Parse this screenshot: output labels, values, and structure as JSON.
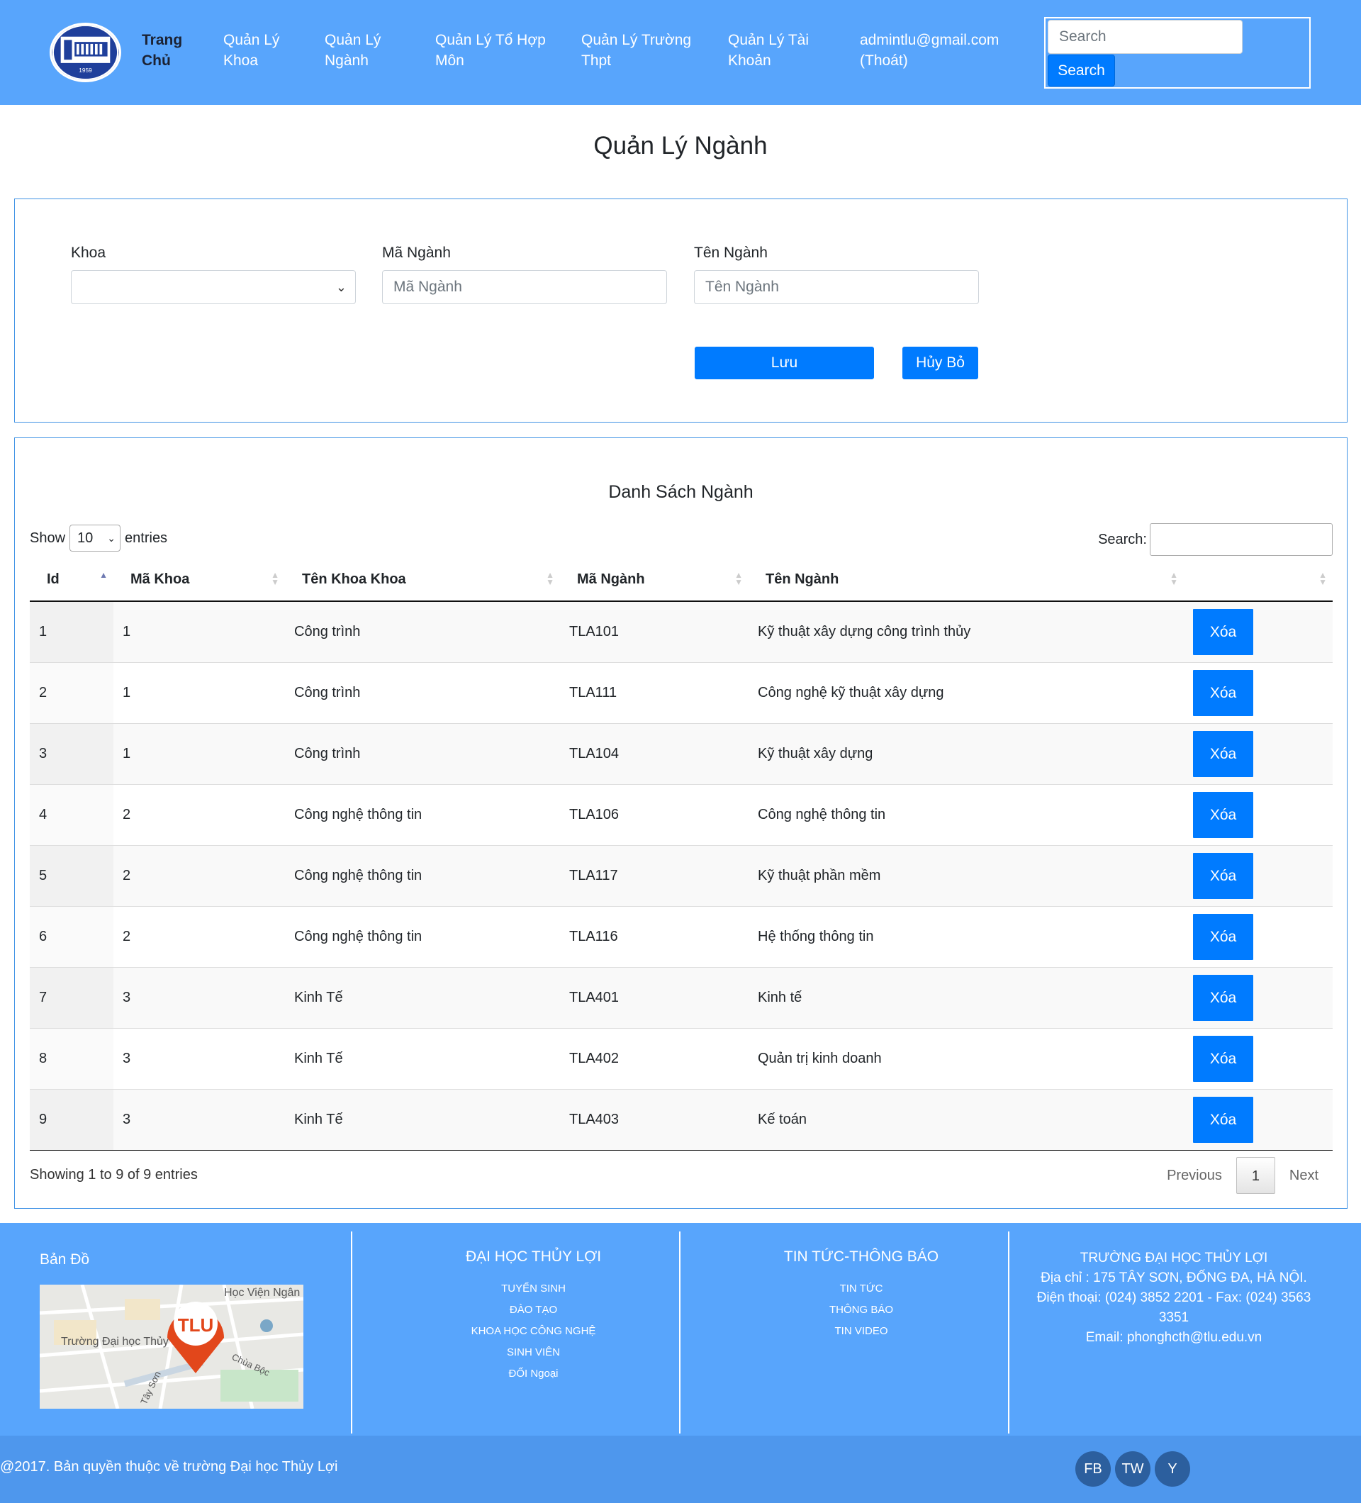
{
  "navbar": {
    "logo_text": "1959",
    "home": "Trang Chủ",
    "items": [
      {
        "label": "Quản Lý Khoa"
      },
      {
        "label": "Quản Lý Ngành"
      },
      {
        "label": "Quản Lý Tổ Hợp Môn"
      },
      {
        "label": "Quản Lý Trường Thpt"
      },
      {
        "label": "Quản Lý Tài Khoản"
      }
    ],
    "account": "admintlu@gmail.com (Thoát)",
    "search_placeholder": "Search",
    "search_button": "Search"
  },
  "page_title": "Quản Lý Ngành",
  "form": {
    "khoa_label": "Khoa",
    "khoa_value": "",
    "ma_nganh_label": "Mã Ngành",
    "ma_nganh_placeholder": "Mã Ngành",
    "ten_nganh_label": "Tên Ngành",
    "ten_nganh_placeholder": "Tên Ngành",
    "save_button": "Lưu",
    "cancel_button": "Hủy Bỏ"
  },
  "table": {
    "title": "Danh Sách Ngành",
    "show_label": "Show",
    "page_length": "10",
    "entries_label": "entries",
    "search_label": "Search:",
    "columns": [
      "Id",
      "Mã Khoa",
      "Tên Khoa Khoa",
      "Mã Ngành",
      "Tên Ngành",
      ""
    ],
    "delete_label": "Xóa",
    "rows": [
      {
        "id": "1",
        "ma_khoa": "1",
        "ten_khoa": "Công trình",
        "ma_nganh": "TLA101",
        "ten_nganh": "Kỹ thuật xây dựng công trình thủy"
      },
      {
        "id": "2",
        "ma_khoa": "1",
        "ten_khoa": "Công trình",
        "ma_nganh": "TLA111",
        "ten_nganh": "Công nghệ kỹ thuật xây dựng"
      },
      {
        "id": "3",
        "ma_khoa": "1",
        "ten_khoa": "Công trình",
        "ma_nganh": "TLA104",
        "ten_nganh": "Kỹ thuật xây dựng"
      },
      {
        "id": "4",
        "ma_khoa": "2",
        "ten_khoa": "Công nghệ thông tin",
        "ma_nganh": "TLA106",
        "ten_nganh": "Công nghệ thông tin"
      },
      {
        "id": "5",
        "ma_khoa": "2",
        "ten_khoa": "Công nghệ thông tin",
        "ma_nganh": "TLA117",
        "ten_nganh": "Kỹ thuật phần mềm"
      },
      {
        "id": "6",
        "ma_khoa": "2",
        "ten_khoa": "Công nghệ thông tin",
        "ma_nganh": "TLA116",
        "ten_nganh": "Hệ thống thông tin"
      },
      {
        "id": "7",
        "ma_khoa": "3",
        "ten_khoa": "Kinh Tế",
        "ma_nganh": "TLA401",
        "ten_nganh": "Kinh tế"
      },
      {
        "id": "8",
        "ma_khoa": "3",
        "ten_khoa": "Kinh Tế",
        "ma_nganh": "TLA402",
        "ten_nganh": "Quản trị kinh doanh"
      },
      {
        "id": "9",
        "ma_khoa": "3",
        "ten_khoa": "Kinh Tế",
        "ma_nganh": "TLA403",
        "ten_nganh": "Kế toán"
      }
    ],
    "info": "Showing 1 to 9 of 9 entries",
    "pager": {
      "previous": "Previous",
      "current": "1",
      "next": "Next"
    }
  },
  "footer": {
    "map_title": "Bản Đồ",
    "map_labels": {
      "pin": "TLU",
      "academy": "Học Viện Ngân Hàng",
      "school": "Trường Đại học Thủy Lợi",
      "street1": "Chùa Bộc",
      "street2": "Tây Sơn"
    },
    "col1_title": "ĐẠI HỌC THỦY LỢI",
    "col1_links": [
      "TUYỂN SINH",
      "ĐÀO TẠO",
      "KHOA HỌC CÔNG NGHỆ",
      "SINH VIÊN",
      "ĐỐI Ngoại"
    ],
    "col2_title": "TIN TỨC-THÔNG BÁO",
    "col2_links": [
      "TIN TỨC",
      "THÔNG BÁO",
      "TIN VIDEO"
    ],
    "contact": {
      "title": "TRƯỜNG ĐẠI HỌC THỦY LỢI",
      "address": "Địa chỉ : 175 TÂY SƠN, ĐỐNG ĐA, HÀ NỘI.",
      "phone": "Điện thoại: (024) 3852 2201 - Fax: (024) 3563 3351",
      "email": "Email: phonghcth@tlu.edu.vn"
    },
    "copyright": "@2017. Bản quyền thuộc về trường Đại học Thủy Lợi",
    "social": [
      "FB",
      "TW",
      "Y"
    ]
  },
  "colors": {
    "navbar": "#58a5fc",
    "primary_button": "#007bff",
    "card_border": "#3f92e5",
    "footer_bottom": "#4e97ed"
  }
}
